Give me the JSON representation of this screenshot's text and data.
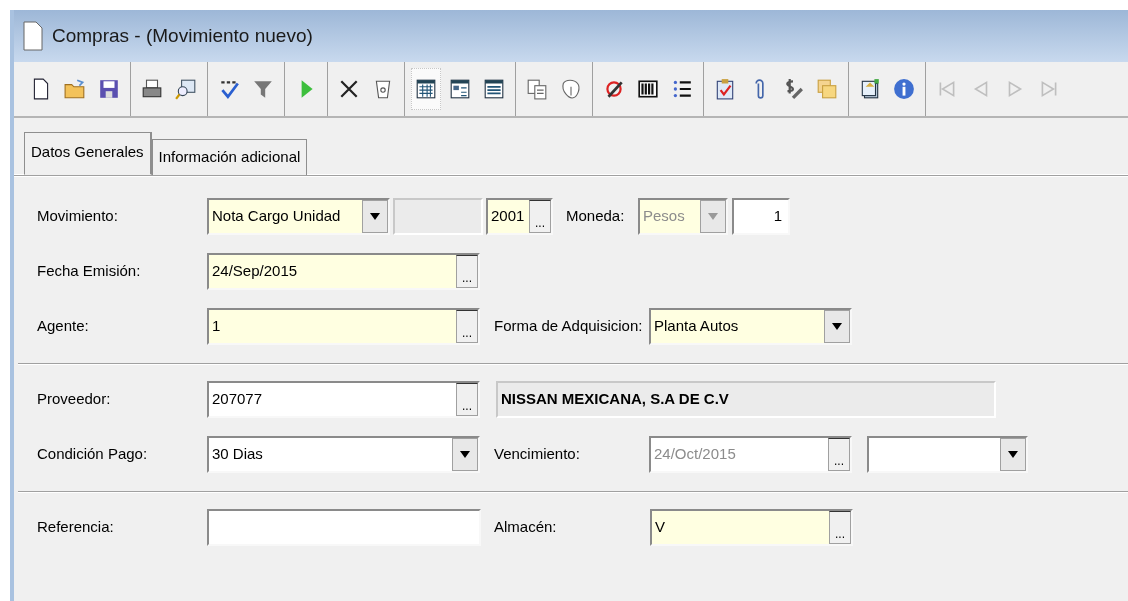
{
  "window": {
    "title": "Compras - (Movimiento nuevo)"
  },
  "toolbar": [
    [
      {
        "kind": "new",
        "pressed": false,
        "disabled": false
      },
      {
        "kind": "open",
        "pressed": false,
        "disabled": false
      },
      {
        "kind": "save",
        "pressed": false,
        "disabled": false
      }
    ],
    [
      {
        "kind": "print",
        "pressed": false,
        "disabled": false
      },
      {
        "kind": "preview",
        "pressed": false,
        "disabled": false
      }
    ],
    [
      {
        "kind": "spell",
        "pressed": false,
        "disabled": false
      },
      {
        "kind": "filter",
        "pressed": false,
        "disabled": false
      }
    ],
    [
      {
        "kind": "run",
        "pressed": false,
        "disabled": false
      }
    ],
    [
      {
        "kind": "delete",
        "pressed": false,
        "disabled": false
      },
      {
        "kind": "bin",
        "pressed": false,
        "disabled": false
      }
    ],
    [
      {
        "kind": "grid",
        "pressed": true,
        "disabled": false
      },
      {
        "kind": "form",
        "pressed": false,
        "disabled": false
      },
      {
        "kind": "listview",
        "pressed": false,
        "disabled": false
      }
    ],
    [
      {
        "kind": "copy",
        "pressed": false,
        "disabled": false
      },
      {
        "kind": "shape",
        "pressed": false,
        "disabled": false
      }
    ],
    [
      {
        "kind": "pen",
        "pressed": false,
        "disabled": false
      },
      {
        "kind": "barcode",
        "pressed": false,
        "disabled": false
      },
      {
        "kind": "bullets",
        "pressed": false,
        "disabled": false
      }
    ],
    [
      {
        "kind": "clipboard",
        "pressed": false,
        "disabled": false
      },
      {
        "kind": "clip",
        "pressed": false,
        "disabled": false
      },
      {
        "kind": "dollar",
        "pressed": false,
        "disabled": false
      },
      {
        "kind": "folders",
        "pressed": false,
        "disabled": false
      }
    ],
    [
      {
        "kind": "docs",
        "pressed": false,
        "disabled": false
      },
      {
        "kind": "info",
        "pressed": false,
        "disabled": false
      }
    ],
    [
      {
        "kind": "first",
        "pressed": false,
        "disabled": true
      },
      {
        "kind": "prev",
        "pressed": false,
        "disabled": true
      },
      {
        "kind": "next",
        "pressed": false,
        "disabled": true
      },
      {
        "kind": "last",
        "pressed": false,
        "disabled": true
      }
    ]
  ],
  "tabs": [
    {
      "label": "Datos Generales",
      "selected": true
    },
    {
      "label": "Información adicional",
      "selected": false
    }
  ],
  "sections": [
    [
      [
        {
          "kind": "label",
          "text": "Movimiento:"
        },
        {
          "kind": "combo",
          "value": "Nota Cargo Unidad",
          "required": true,
          "disabled": false
        },
        {
          "kind": "display"
        },
        {
          "kind": "lookup",
          "value": "2001",
          "button": "...",
          "required": true,
          "disabled": false
        },
        {
          "kind": "label",
          "text": "Moneda:"
        },
        {
          "kind": "combo",
          "value": "Pesos",
          "required": true,
          "disabled": true
        },
        {
          "kind": "number",
          "value": "1",
          "required": false,
          "disabled": false
        }
      ],
      [
        {
          "kind": "label",
          "text": "Fecha Emisión:"
        },
        {
          "kind": "lookup",
          "value": "24/Sep/2015",
          "button": "...",
          "required": true,
          "disabled": false
        }
      ],
      [
        {
          "kind": "label",
          "text": "Agente:"
        },
        {
          "kind": "lookup",
          "value": "1",
          "button": "...",
          "required": true,
          "disabled": false
        },
        {
          "kind": "label",
          "text": "Forma de Adquisicion:"
        },
        {
          "kind": "combo",
          "value": "Planta Autos",
          "required": true,
          "disabled": false
        }
      ]
    ],
    [
      [
        {
          "kind": "label",
          "text": "Proveedor:"
        },
        {
          "kind": "lookup",
          "value": "207077",
          "button": "...",
          "required": false,
          "disabled": false
        },
        {
          "kind": "display",
          "value": "NISSAN MEXICANA, S.A DE C.V"
        }
      ],
      [
        {
          "kind": "label",
          "text": "Condición Pago:"
        },
        {
          "kind": "combo",
          "value": "30 Dias",
          "required": false,
          "disabled": false
        },
        {
          "kind": "label",
          "text": "Vencimiento:"
        },
        {
          "kind": "lookup",
          "value": "24/Oct/2015",
          "button": "...",
          "required": false,
          "disabled": true
        },
        {
          "kind": "combo",
          "required": false,
          "disabled": false
        }
      ]
    ],
    [
      [
        {
          "kind": "label",
          "text": "Referencia:"
        },
        {
          "kind": "text",
          "required": false
        },
        {
          "kind": "label",
          "text": "Almacén:"
        },
        {
          "kind": "lookup",
          "value": "V",
          "button": "...",
          "required": true,
          "disabled": false
        }
      ]
    ]
  ]
}
